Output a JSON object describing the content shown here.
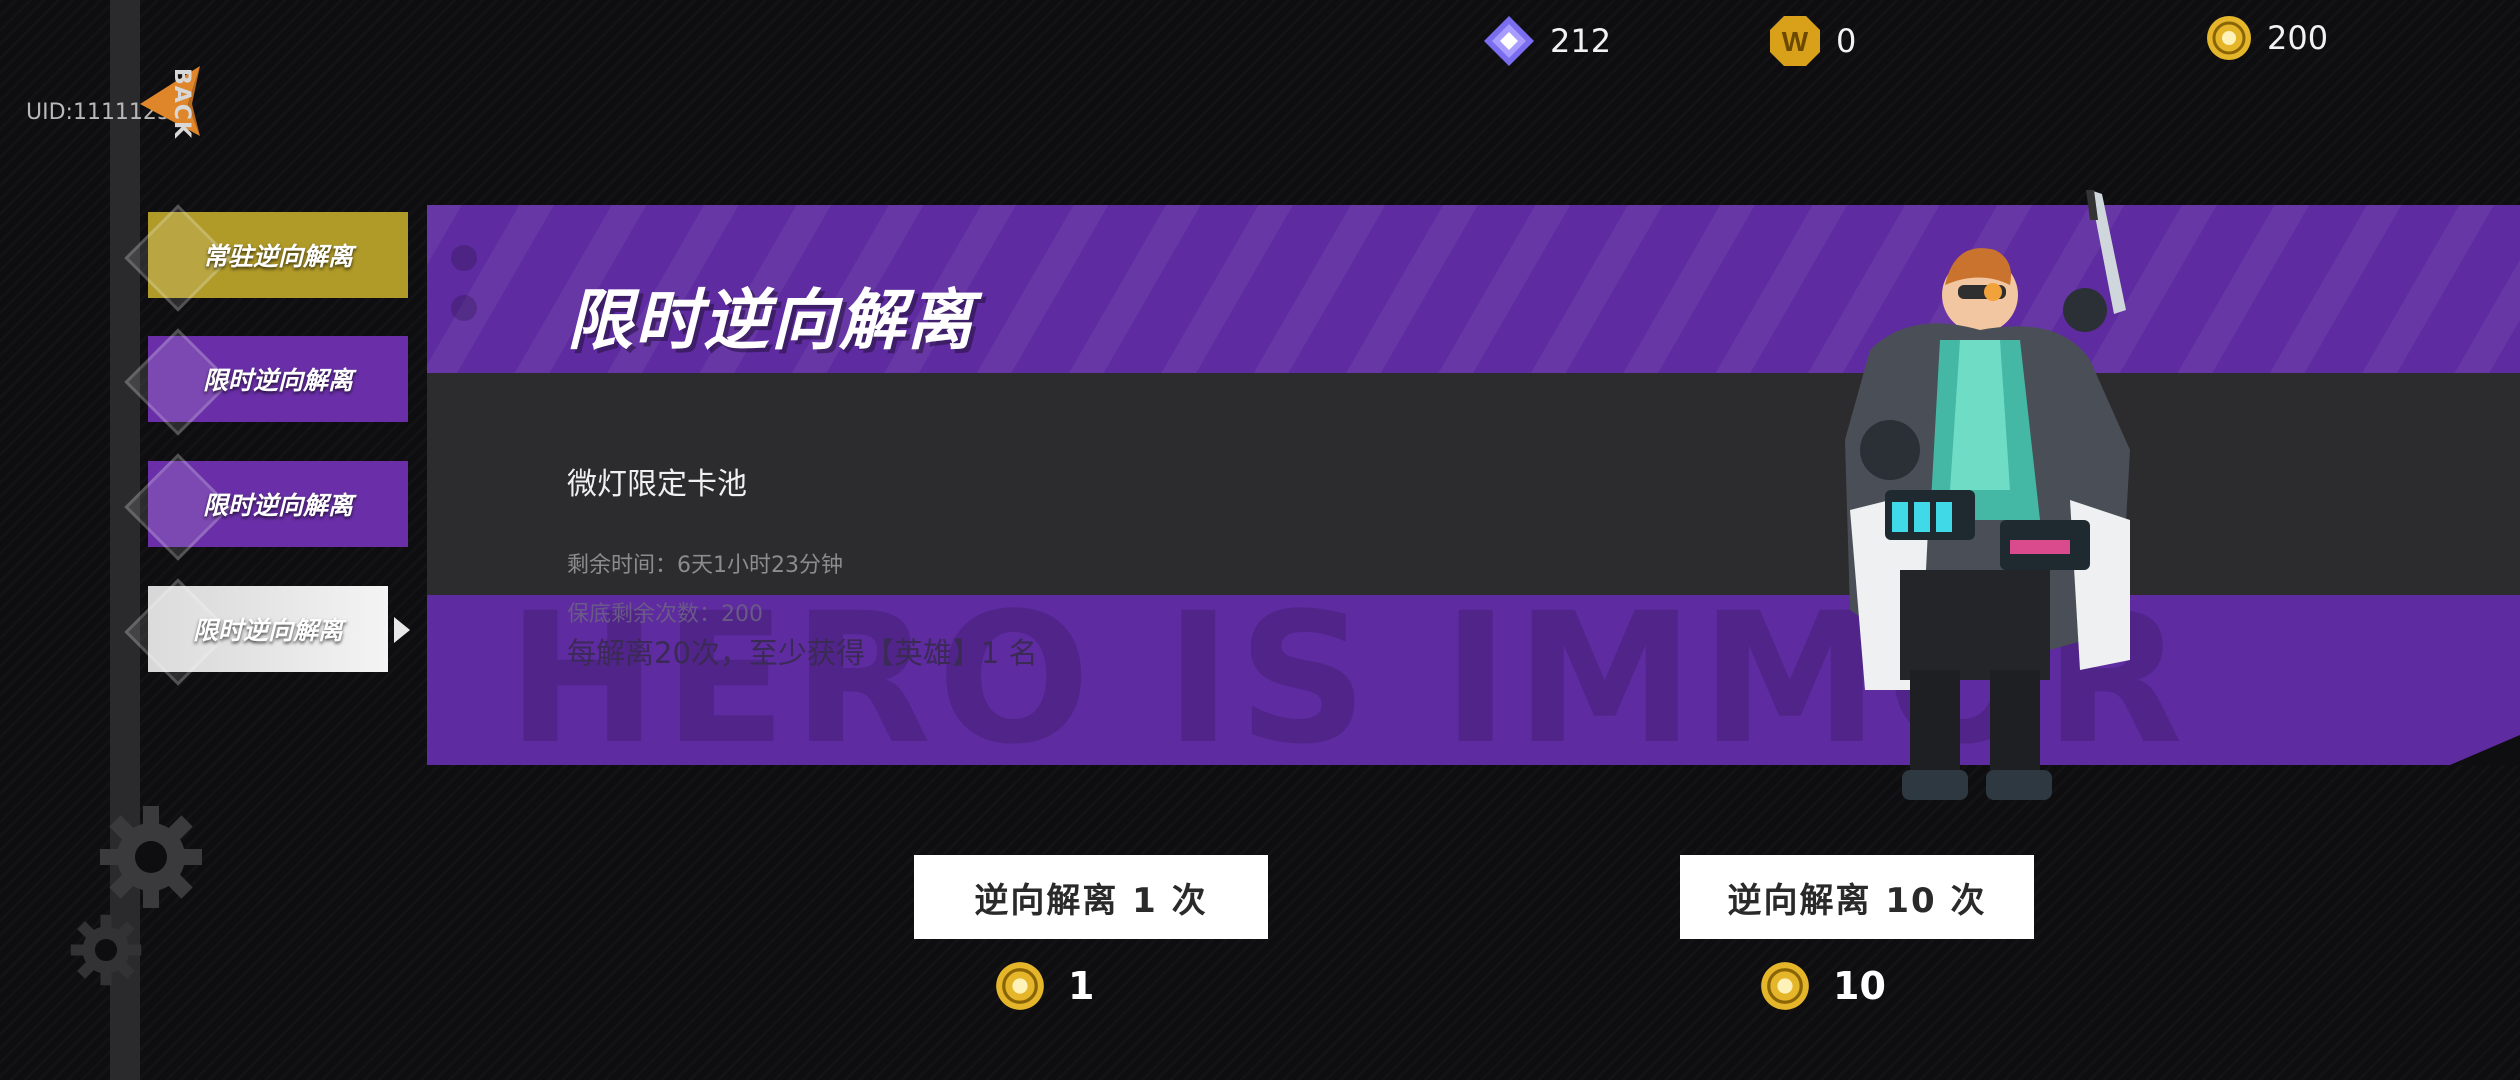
{
  "header": {
    "uid": "UID:11111257",
    "back_label": "BACK",
    "currencies": {
      "gem": "212",
      "w_coin": "0",
      "gold": "200"
    }
  },
  "sidebar": {
    "tabs": [
      {
        "label": "常驻逆向解离"
      },
      {
        "label": "限时逆向解离"
      },
      {
        "label": "限时逆向解离"
      },
      {
        "label": "限时逆向解离"
      }
    ],
    "selected_index": 3
  },
  "banner": {
    "title": "限时逆向解离",
    "pool_name": "微灯限定卡池",
    "remaining_time": "剩余时间：6天1小时23分钟",
    "pity_remaining": "保底剩余次数：200",
    "guarantee_text": "每解离20次，至少获得【英雄】1 名",
    "watermark": "HERO IS IMMOR"
  },
  "actions": {
    "pull_one_label": "逆向解离 1 次",
    "pull_ten_label": "逆向解离 10 次",
    "pull_one_cost": "1",
    "pull_ten_cost": "10"
  },
  "colors": {
    "accent_purple": "#5e2ba0",
    "tab_gold": "#b09a28",
    "back_orange": "#e0862a"
  }
}
